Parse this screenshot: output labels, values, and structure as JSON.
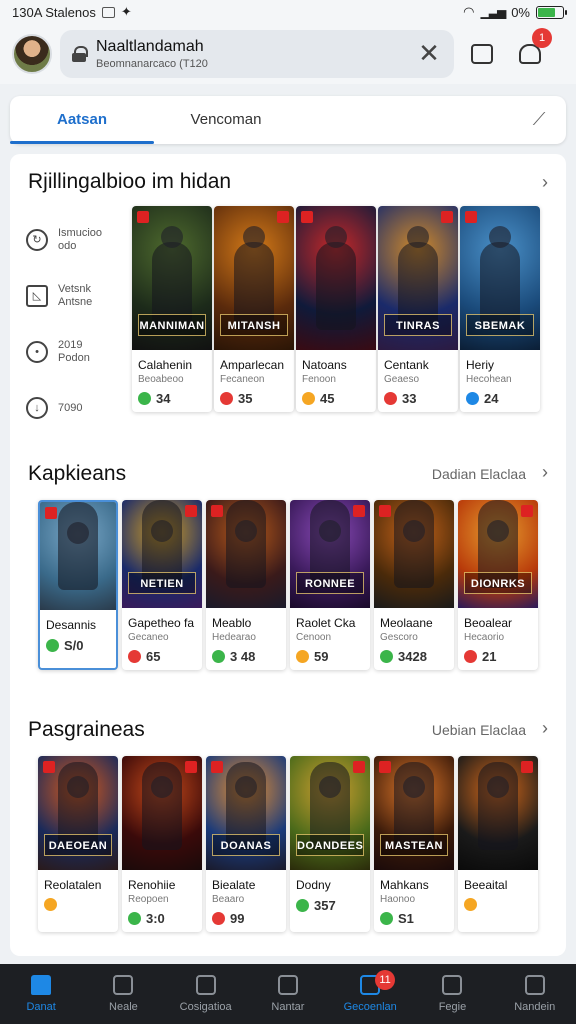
{
  "status_bar": {
    "time": "130A Stalenos",
    "battery_text": "0%",
    "battery_level": 0.7
  },
  "header": {
    "search_title": "Naaltlandamah",
    "search_subtitle": "Beomnanarcaco (T120",
    "close_glyph": "✕",
    "notification_count": "1"
  },
  "tabs": [
    {
      "label": "Aatsan",
      "active": true
    },
    {
      "label": "Vencoman",
      "active": false
    }
  ],
  "sections": [
    {
      "title": "Rjillingalbioo im hidan",
      "link": "",
      "sidebar": [
        {
          "icon": "refresh-icon",
          "line1": "Ismucioo",
          "line2": "odo"
        },
        {
          "icon": "image-icon",
          "line1": "Vetsnk",
          "line2": "Antsne"
        },
        {
          "icon": "location-icon",
          "line1": "2019",
          "line2": "Podon"
        },
        {
          "icon": "clock-icon",
          "line1": "7090",
          "line2": ""
        }
      ],
      "cards": [
        {
          "name": "Calahenin",
          "sub": "Beoabeoo",
          "rating": "34",
          "banner": "MANNIMAN",
          "colors": [
            "#1c2a1a",
            "#4f6b2e",
            "#111"
          ],
          "dot": "#3bb54a"
        },
        {
          "name": "Amparlecan",
          "sub": "Fecaneon",
          "rating": "35",
          "banner": "MITANSH",
          "colors": [
            "#5a2a0c",
            "#d47a18",
            "#2a1506"
          ],
          "dot": "#e53935"
        },
        {
          "name": "Natoans",
          "sub": "Fenoon",
          "rating": "45",
          "banner": "",
          "colors": [
            "#0f1a3a",
            "#c62828",
            "#3a0a12"
          ],
          "dot": "#f5a623"
        },
        {
          "name": "Centank",
          "sub": "Geaeso",
          "rating": "33",
          "banner": "TINRAS",
          "colors": [
            "#1a2a6a",
            "#d08a2a",
            "#2c1a40"
          ],
          "dot": "#e53935"
        },
        {
          "name": "Heriy",
          "sub": "Hecohean",
          "rating": "24",
          "banner": "SBEMAK",
          "colors": [
            "#1a4a7a",
            "#4a90c8",
            "#0b1e35"
          ],
          "dot": "#1e88e5"
        }
      ]
    },
    {
      "title": "Kapkieans",
      "link": "Dadian Elaclaa",
      "cards": [
        {
          "name": "Desannis",
          "sub": "",
          "rating": "S/0",
          "banner": "",
          "colors": [
            "#3a6a8a",
            "#7aa8c8",
            "#2a3a4a"
          ],
          "dot": "#3bb54a",
          "selected": true
        },
        {
          "name": "Gapetheo fa",
          "sub": "Gecaneo",
          "rating": "65",
          "banner": "NETIEN",
          "colors": [
            "#1a2a6a",
            "#d4a020",
            "#3a1a5a"
          ],
          "dot": "#e53935"
        },
        {
          "name": "Meablo",
          "sub": "Hedearao",
          "rating": "3 48",
          "banner": "",
          "colors": [
            "#3a1a1a",
            "#b85a1a",
            "#1a1a2a"
          ],
          "dot": "#3bb54a"
        },
        {
          "name": "Raolet Cka",
          "sub": "Cenoon",
          "rating": "59",
          "banner": "RONNEE",
          "colors": [
            "#3a1a5a",
            "#8a4ab8",
            "#1a0a2a"
          ],
          "dot": "#f5a623"
        },
        {
          "name": "Meolaane",
          "sub": "Gescoro",
          "rating": "3428",
          "banner": "",
          "colors": [
            "#4a2a0a",
            "#c8641a",
            "#1a1a1a"
          ],
          "dot": "#3bb54a"
        },
        {
          "name": "Beoalear",
          "sub": "Hecaorio",
          "rating": "21",
          "banner": "DIONRKS",
          "colors": [
            "#b83a0a",
            "#e8a030",
            "#2a1a5a"
          ],
          "dot": "#e53935"
        }
      ]
    },
    {
      "title": "Pasgraineas",
      "link": "Uebian Elaclaa",
      "cards": [
        {
          "name": "Reolatalen",
          "sub": "",
          "rating": "",
          "banner": "DAEOEAN",
          "colors": [
            "#1a2a5a",
            "#d85a1a",
            "#2a1a1a"
          ],
          "dot": "#f5a623"
        },
        {
          "name": "Renohiie",
          "sub": "Reopoen",
          "rating": "3:0",
          "banner": "",
          "colors": [
            "#3a0a0a",
            "#c84a1a",
            "#1a0a0a"
          ],
          "dot": "#3bb54a"
        },
        {
          "name": "Biealate",
          "sub": "Beaaro",
          "rating": "99",
          "banner": "DOANAS",
          "colors": [
            "#1a3a7a",
            "#e89030",
            "#1a1a2a"
          ],
          "dot": "#e53935"
        },
        {
          "name": "Dodny",
          "sub": "",
          "rating": "357",
          "banner": "DOANDEES",
          "colors": [
            "#4a6a1a",
            "#d0a030",
            "#2a2a0a"
          ],
          "dot": "#3bb54a"
        },
        {
          "name": "Mahkans",
          "sub": "Haonoo",
          "rating": "S1",
          "banner": "MASTEAN",
          "colors": [
            "#3a1a0a",
            "#e0782a",
            "#1a0a0a"
          ],
          "dot": "#3bb54a"
        },
        {
          "name": "Beeaital",
          "sub": "",
          "rating": "",
          "banner": "",
          "colors": [
            "#1a1a1a",
            "#d86a1a",
            "#0a0a0a"
          ],
          "dot": "#f5a623"
        }
      ]
    }
  ],
  "bottom_nav": [
    {
      "label": "Danat",
      "icon": "home-icon",
      "active": true
    },
    {
      "label": "Neale",
      "icon": "graph-icon",
      "active": false
    },
    {
      "label": "Cosigatioa",
      "icon": "box-icon",
      "active": false
    },
    {
      "label": "Nantar",
      "icon": "chat-icon",
      "active": false
    },
    {
      "label": "Gecoenlan",
      "icon": "inbox-icon",
      "active": true,
      "badge": "11"
    },
    {
      "label": "Fegie",
      "icon": "edit-icon",
      "active": false
    },
    {
      "label": "Nandein",
      "icon": "profile-icon",
      "active": false
    }
  ]
}
